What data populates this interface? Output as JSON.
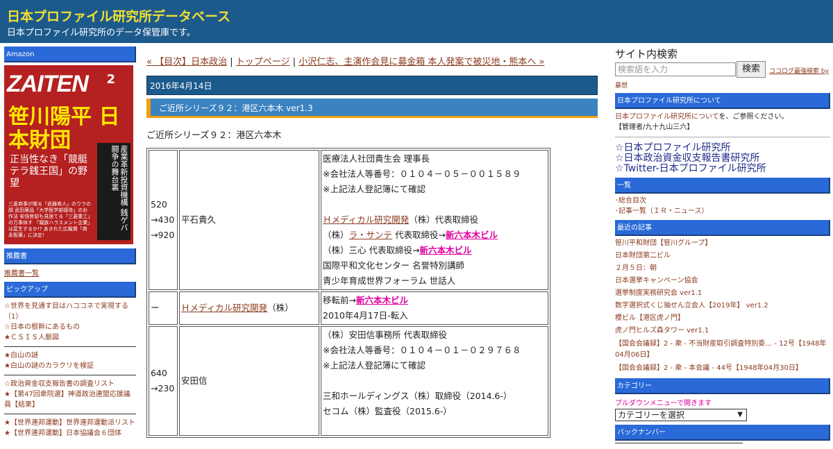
{
  "header": {
    "title": "日本プロファイル研究所データベース",
    "description": "日本プロファイル研究所のデータ保管庫です。"
  },
  "left": {
    "amazon_head": "Amazon",
    "zaiten": {
      "masthead": "ZAITEN",
      "issue": "2",
      "headline": "笹川陽平 日本財団",
      "subhead": "正当性なき「競艇テラ銭王国」の野望",
      "vertical": "産業革新投資機構 銭ゲバ闘争の舞台裏",
      "foot": "三菱商事が贈る「武器商人」のウラの顔 武田薬品「大学医学部接待」のお作法 安倍官邸も見捨てる「三菱重工」の万事休す 「親族ハラスメント企業」は変生するか!? あきれた広報賞「商永製薬」に決定!"
    },
    "recommend_head": "推薦書",
    "recommend_link": "推薦書一覧",
    "pickup_head": "ピックアップ",
    "pickup_items": [
      "☆世界を見通す目はハココネで実現する（1）",
      "☆日本の根幹にあるもの",
      "★ＣＳＩＳ人脈図",
      "★白山の謎",
      "★白山の謎のカラクリを検証",
      "☆政治資金収支報告書の調査リスト",
      "★【第47回衆院選】神道政治連盟応援議員【結果】",
      "★【世界連邦運動】世界連邦運動派リスト",
      "★【世界連邦運動】日本協議会６団体"
    ]
  },
  "main": {
    "nav_prev": "« 【目次】日本政治",
    "nav_sep1": "|",
    "nav_top": "トップページ",
    "nav_sep2": "|",
    "nav_next": "小沢仁志、主演作会見に募金箱 本人発案で被災地・熊本へ »",
    "date": "2016年4月14日",
    "entry_title": "ご近所シリーズ９２：港区六本木 ver1.3",
    "entry_intro": "ご近所シリーズ９２：港区六本木",
    "rows": [
      {
        "code_lines": [
          "520",
          "→430",
          "→920"
        ],
        "name": "平石貴久",
        "detail": {
          "l1": "医療法人社団貴生会 理事長",
          "l2": "※会社法人等番号：０１０４－０５－００１５８９",
          "l3": "※上記法人登記簿にて確認",
          "l4_link": "Ｈメディカル研究開発",
          "l4_rest": "（株）代表取締役",
          "l5_pre": "（株）",
          "l5_link": "ラ・サンテ",
          "l5_mid": " 代表取締役→",
          "l5_pink": "新六本木ビル",
          "l6_pre": "（株）三心 代表取締役→",
          "l6_pink": "新六本木ビル",
          "l7": "国際平和文化センター 名誉特別講師",
          "l8": "青少年育成世界フォーラム 世話人"
        }
      },
      {
        "code": "ー",
        "name_link": "Ｈメディカル研究開発",
        "name_rest": "（株）",
        "detail": {
          "l1_pre": "移転前→",
          "l1_pink": "新六本木ビル",
          "l2": "2010年4月17日-転入"
        }
      },
      {
        "code_lines": [
          "640",
          "→230"
        ],
        "name": "安田信",
        "detail": {
          "l1": "（株）安田信事務所 代表取締役",
          "l2": "※会社法人等番号：０１０４－０１－０２９７６８",
          "l3": "※上記法人登記簿にて確認",
          "l4": "三和ホールディングス（株）取締役（2014.6-）",
          "l5": "セコム（株）監査役（2015.6-）"
        }
      }
    ]
  },
  "right": {
    "search_title": "サイト内検索",
    "search_placeholder": "検索語を入力",
    "search_button": "検索",
    "search_note": "ココログ最強検索 by",
    "search_author": "暴想",
    "about_head": "日本プロファイル研究所について",
    "about_link": "日本プロファイル研究所について",
    "about_suffix": "を、ご参照ください。",
    "about_admin": "【管理者/九十九山三六】",
    "big_links": [
      "☆日本プロファイル研究所",
      "☆日本政治資金収支報告書研究所",
      "☆Twitter-日本プロファイル研究所"
    ],
    "list_head": "一覧",
    "list_items": [
      "･総合目次",
      "･記事一覧（ＩＲ・ニュース）"
    ],
    "recent_head": "最近の記事",
    "recent_items": [
      "笹川平和財団【笹川グループ】",
      "日本財団第二ビル",
      "２月５日：朝",
      "日本選挙キャンペーン協会",
      "選挙制度実務研究会 ver1.1",
      "数字選択式くじ抽せん立会人【2019年】 ver1.2",
      "櫻ビル【港区虎ノ門】",
      "虎ノ門ヒルズ森タワー ver1.1",
      "【国会会議録】2 - 衆 - 不当財産取引調査特別委… - 12号【1948年04月06日】",
      "【国会会議録】2 - 衆 - 本会議 - 44号【1948年04月30日】"
    ],
    "category_head": "カテゴリー",
    "category_note": "プルダウンメニューで開きます",
    "category_select": "カテゴリーを選択",
    "backnumber_head": "バックナンバー"
  }
}
